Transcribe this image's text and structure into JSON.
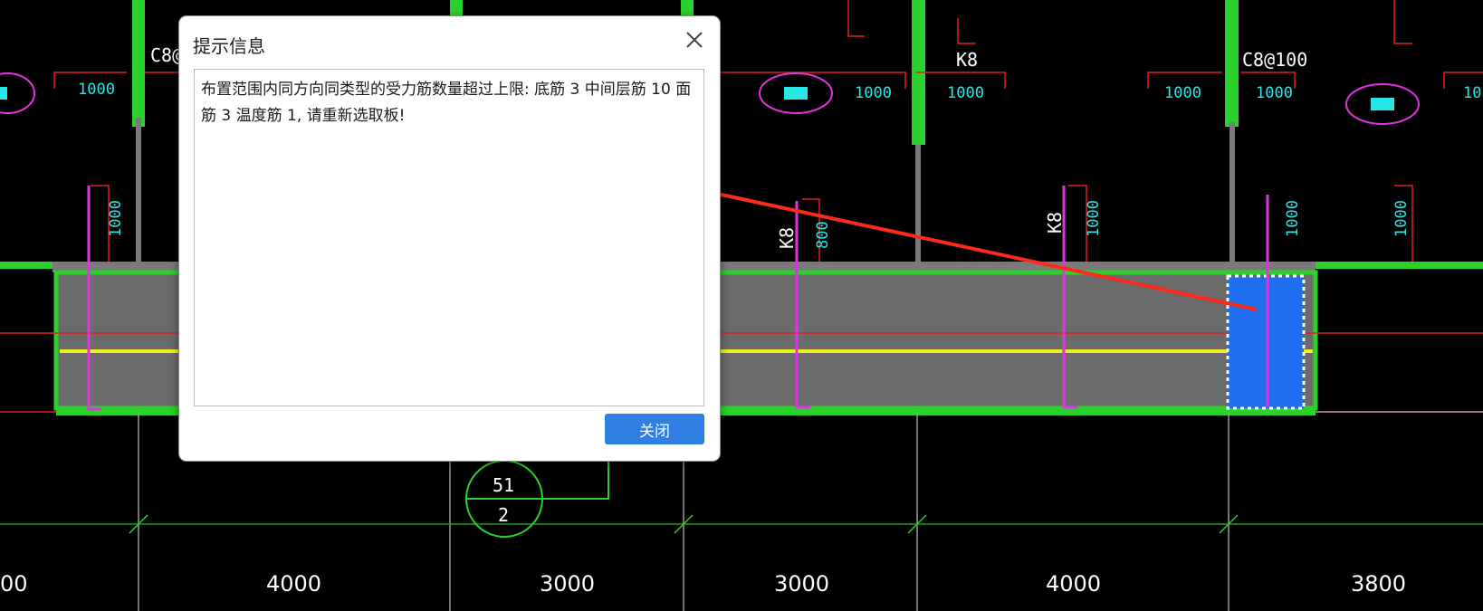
{
  "dialog": {
    "title": "提示信息",
    "message": "布置范围内同方向同类型的受力筋数量超过上限: 底筋 3 中间层筋 10 面筋 3 温度筋 1, 请重新选取板!",
    "close_button_label": "关闭",
    "close_icon": "close-icon"
  },
  "drawing": {
    "span_dimensions": [
      "00",
      "4000",
      "3000",
      "3000",
      "4000",
      "3800"
    ],
    "rebar_labels": {
      "c8_100_left": "C8@",
      "c8_100_right": "C8@100",
      "k8_top": "K8",
      "k8_mid": "K8",
      "k8_right": "K8"
    },
    "length_labels": {
      "top_1000_a": "1000",
      "top_1000_b": "1000",
      "top_1000_c": "1000",
      "top_1000_d": "1000",
      "top_1000_e": "1000",
      "top_10_partial": "10",
      "vert_1000_a": "1000",
      "vert_1000_b": "1000",
      "vert_1000_c": "1000",
      "vert_1000_d": "1000",
      "vert_800": "800"
    },
    "axis_tag": {
      "top": "51",
      "bottom": "2"
    },
    "colors": {
      "background": "#000000",
      "beam_green": "#2bd22b",
      "slab_gray": "#6b6b6b",
      "magenta": "#e233e2",
      "red": "#e02020",
      "yellow": "#f0f020",
      "selected_blue": "#1f6ff0",
      "cyan_text": "#27e6e6",
      "annotation_arrow": "#ff2a1a",
      "dialog_button": "#2f7fe3"
    }
  }
}
